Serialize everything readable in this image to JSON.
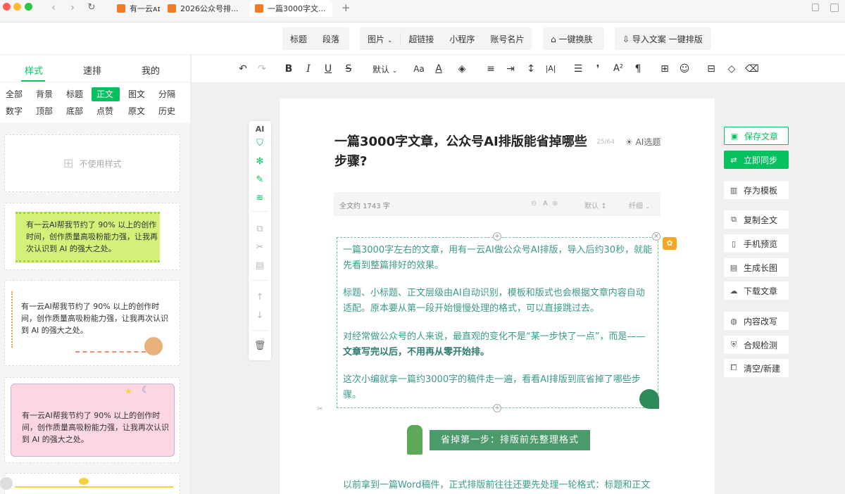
{
  "browser": {
    "tabs": [
      {
        "label": "有一云ᴀɪ"
      },
      {
        "label": "2026公众号排..."
      },
      {
        "label": "一篇3000字文..."
      }
    ],
    "new_tab": "+"
  },
  "topbar": {
    "group1": [
      "标题",
      "段落"
    ],
    "image": "图片",
    "group2": [
      "超链接",
      "小程序",
      "账号名片"
    ],
    "skin": "一键换肤",
    "import": "导入文案 一键排版"
  },
  "left": {
    "tabs": [
      "样式",
      "速排",
      "我的"
    ],
    "chips_row1": [
      "全部",
      "背景",
      "标题",
      "正文",
      "图文",
      "分隔"
    ],
    "chips_row2": [
      "数字",
      "顶部",
      "底部",
      "点赞",
      "原文",
      "历史"
    ],
    "no_style": "不使用样式",
    "sample_text": "有一云AI帮我节约了 90% 以上的创作时间，创作质量高吸粉能力强，让我再次认识到 AI 的强大之处。"
  },
  "fmt": {
    "font_default": "默认"
  },
  "tools": {
    "ai": "AI"
  },
  "article": {
    "title": "一篇3000字文章，公众号AI排版能省掉哪些步骤?",
    "title_count": "25/64",
    "ai_topic": "AI选题",
    "word_count": "全文约 1743 字",
    "font_a": "A",
    "spacing": "默认",
    "fine": "纤细",
    "p1": "一篇3000字左右的文章，用有一云AI做公众号AI排版，导入后约30秒，就能先看到整篇排好的效果。",
    "p2": "标题、小标题、正文层级由AI自动识别，模板和版式也会根据文章内容自动适配。原本要从第一段开始慢慢处理的格式，可以直接跳过去。",
    "p3_a": "对经常做公众号的人来说，最直观的变化不是“某一步快了一点”，而是——",
    "p3_b": "文章写完以后，不用再从零开始排。",
    "p4": "这次小编就拿一篇约3000字的稿件走一遍，看看AI排版到底省掉了哪些步骤。",
    "section": "省掉第一步：排版前先整理格式",
    "p5": "以前拿到一篇Word稿件，正式排版前往往还要先处理一轮格式：标题和正文"
  },
  "right": {
    "save": "保存文章",
    "sync": "立即同步",
    "template": "存为模板",
    "copy": "复制全文",
    "preview": "手机预览",
    "long_image": "生成长图",
    "download": "下载文章",
    "rewrite": "内容改写",
    "compliance": "合规检测",
    "clear": "清空/新建"
  },
  "colors": {
    "accent": "#07c160",
    "text_teal": "#3a9a8a",
    "section_bg": "#4b9a6b"
  }
}
